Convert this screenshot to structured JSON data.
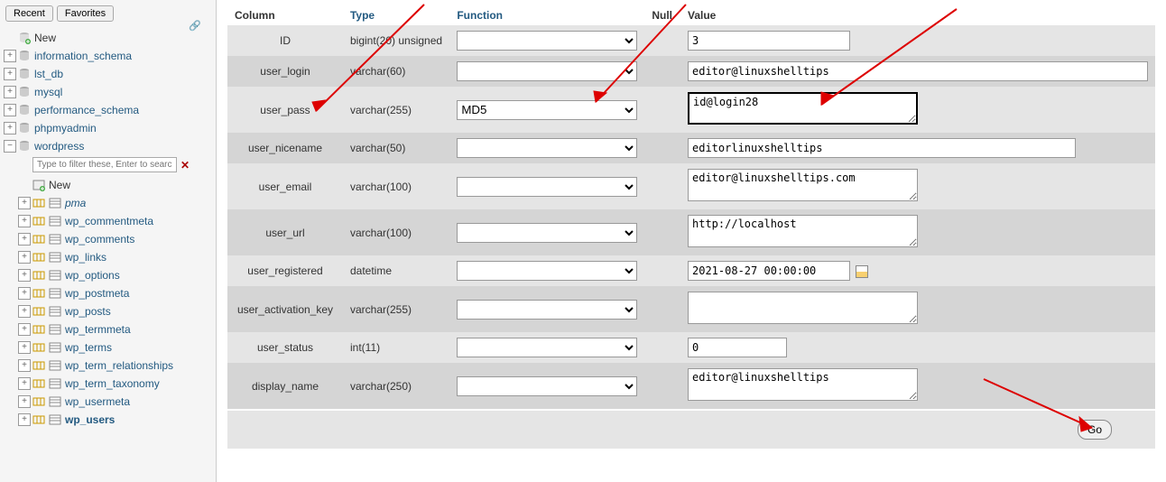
{
  "sidebar": {
    "tabs": {
      "recent": "Recent",
      "favorites": "Favorites"
    },
    "new_label": "New",
    "filter_placeholder": "Type to filter these, Enter to search all",
    "databases": [
      {
        "name": "information_schema"
      },
      {
        "name": "lst_db"
      },
      {
        "name": "mysql"
      },
      {
        "name": "performance_schema"
      },
      {
        "name": "phpmyadmin"
      }
    ],
    "active_db": "wordpress",
    "active_tables": [
      {
        "name": "pma",
        "italic": true
      },
      {
        "name": "wp_commentmeta"
      },
      {
        "name": "wp_comments"
      },
      {
        "name": "wp_links"
      },
      {
        "name": "wp_options"
      },
      {
        "name": "wp_postmeta"
      },
      {
        "name": "wp_posts"
      },
      {
        "name": "wp_termmeta"
      },
      {
        "name": "wp_terms"
      },
      {
        "name": "wp_term_relationships"
      },
      {
        "name": "wp_term_taxonomy"
      },
      {
        "name": "wp_usermeta"
      },
      {
        "name": "wp_users",
        "selected": true
      }
    ]
  },
  "headers": {
    "column": "Column",
    "type": "Type",
    "function": "Function",
    "null": "Null",
    "value": "Value"
  },
  "rows": [
    {
      "col": "ID",
      "type": "bigint(20) unsigned",
      "func": "",
      "value": "3",
      "input": "text",
      "cls": "val-id"
    },
    {
      "col": "user_login",
      "type": "varchar(60)",
      "func": "",
      "value": "editor@linuxshelltips",
      "input": "text",
      "cls": "val-login"
    },
    {
      "col": "user_pass",
      "type": "varchar(255)",
      "func": "MD5",
      "value": "id@login28",
      "input": "textarea",
      "cls": "val-pass"
    },
    {
      "col": "user_nicename",
      "type": "varchar(50)",
      "func": "",
      "value": "editorlinuxshelltips",
      "input": "text",
      "cls": "val-nice"
    },
    {
      "col": "user_email",
      "type": "varchar(100)",
      "func": "",
      "value": "editor@linuxshelltips.com",
      "input": "textarea",
      "cls": "val-email"
    },
    {
      "col": "user_url",
      "type": "varchar(100)",
      "func": "",
      "value": "http://localhost",
      "input": "textarea",
      "cls": "val-url"
    },
    {
      "col": "user_registered",
      "type": "datetime",
      "func": "",
      "value": "2021-08-27 00:00:00",
      "input": "text",
      "cls": "val-reg",
      "cal": true
    },
    {
      "col": "user_activation_key",
      "type": "varchar(255)",
      "func": "",
      "value": "",
      "input": "textarea",
      "cls": "val-act"
    },
    {
      "col": "user_status",
      "type": "int(11)",
      "func": "",
      "value": "0",
      "input": "text",
      "cls": "val-status"
    },
    {
      "col": "display_name",
      "type": "varchar(250)",
      "func": "",
      "value": "editor@linuxshelltips",
      "input": "textarea",
      "cls": "val-disp"
    }
  ],
  "go_label": "Go"
}
